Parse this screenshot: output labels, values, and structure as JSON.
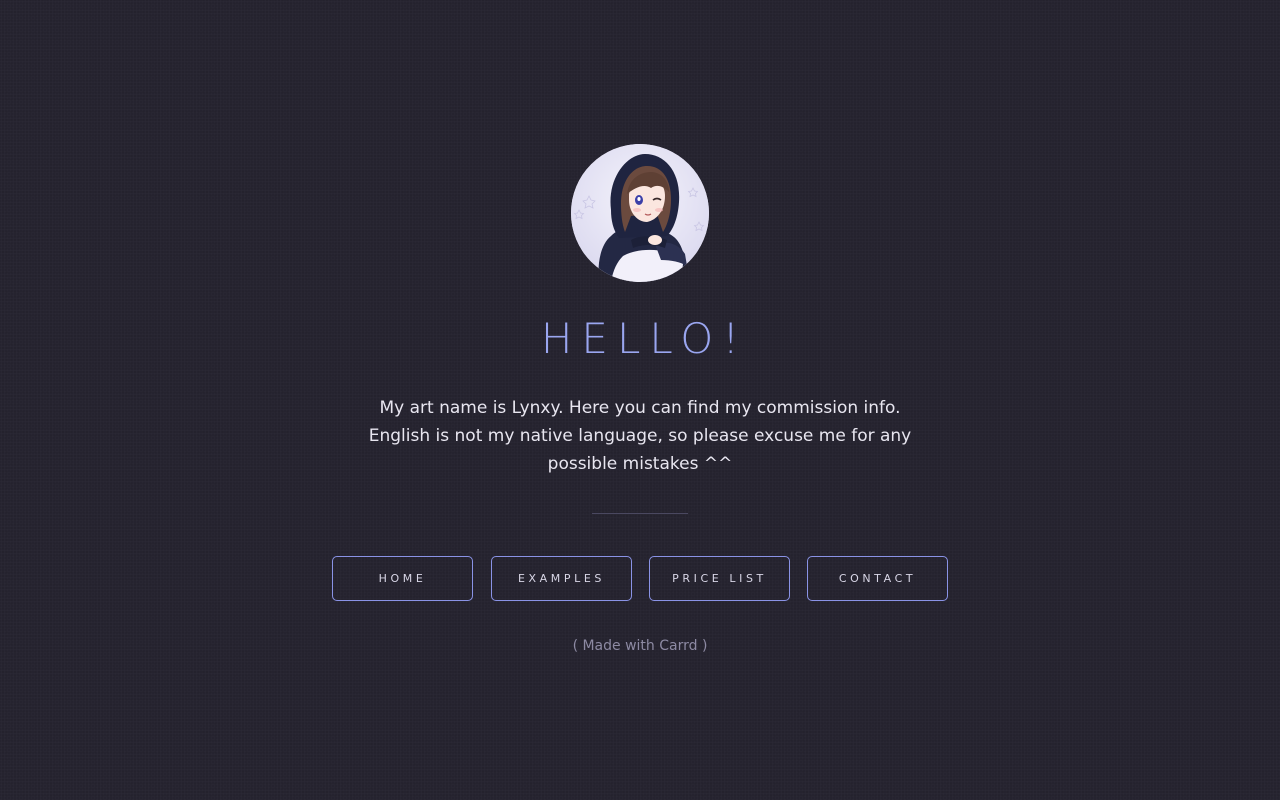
{
  "header": {
    "title": "HELLO!",
    "avatar": "lynxy-avatar-illustration"
  },
  "intro": {
    "line1": "My art name is Lynxy. Here you can find my commission info.",
    "line2": "English is not my native language, so please excuse me for any possible mistakes ^^"
  },
  "nav": {
    "items": [
      {
        "label": "HOME"
      },
      {
        "label": "EXAMPLES"
      },
      {
        "label": "PRICE LIST"
      },
      {
        "label": "CONTACT"
      }
    ]
  },
  "footer": {
    "text": "( Made with Carrd )"
  },
  "colors": {
    "background": "#25232f",
    "accent": "#9aa6f0",
    "button_border": "#8a93e6",
    "text": "#e8e6f0",
    "muted": "#8d8aa3"
  }
}
